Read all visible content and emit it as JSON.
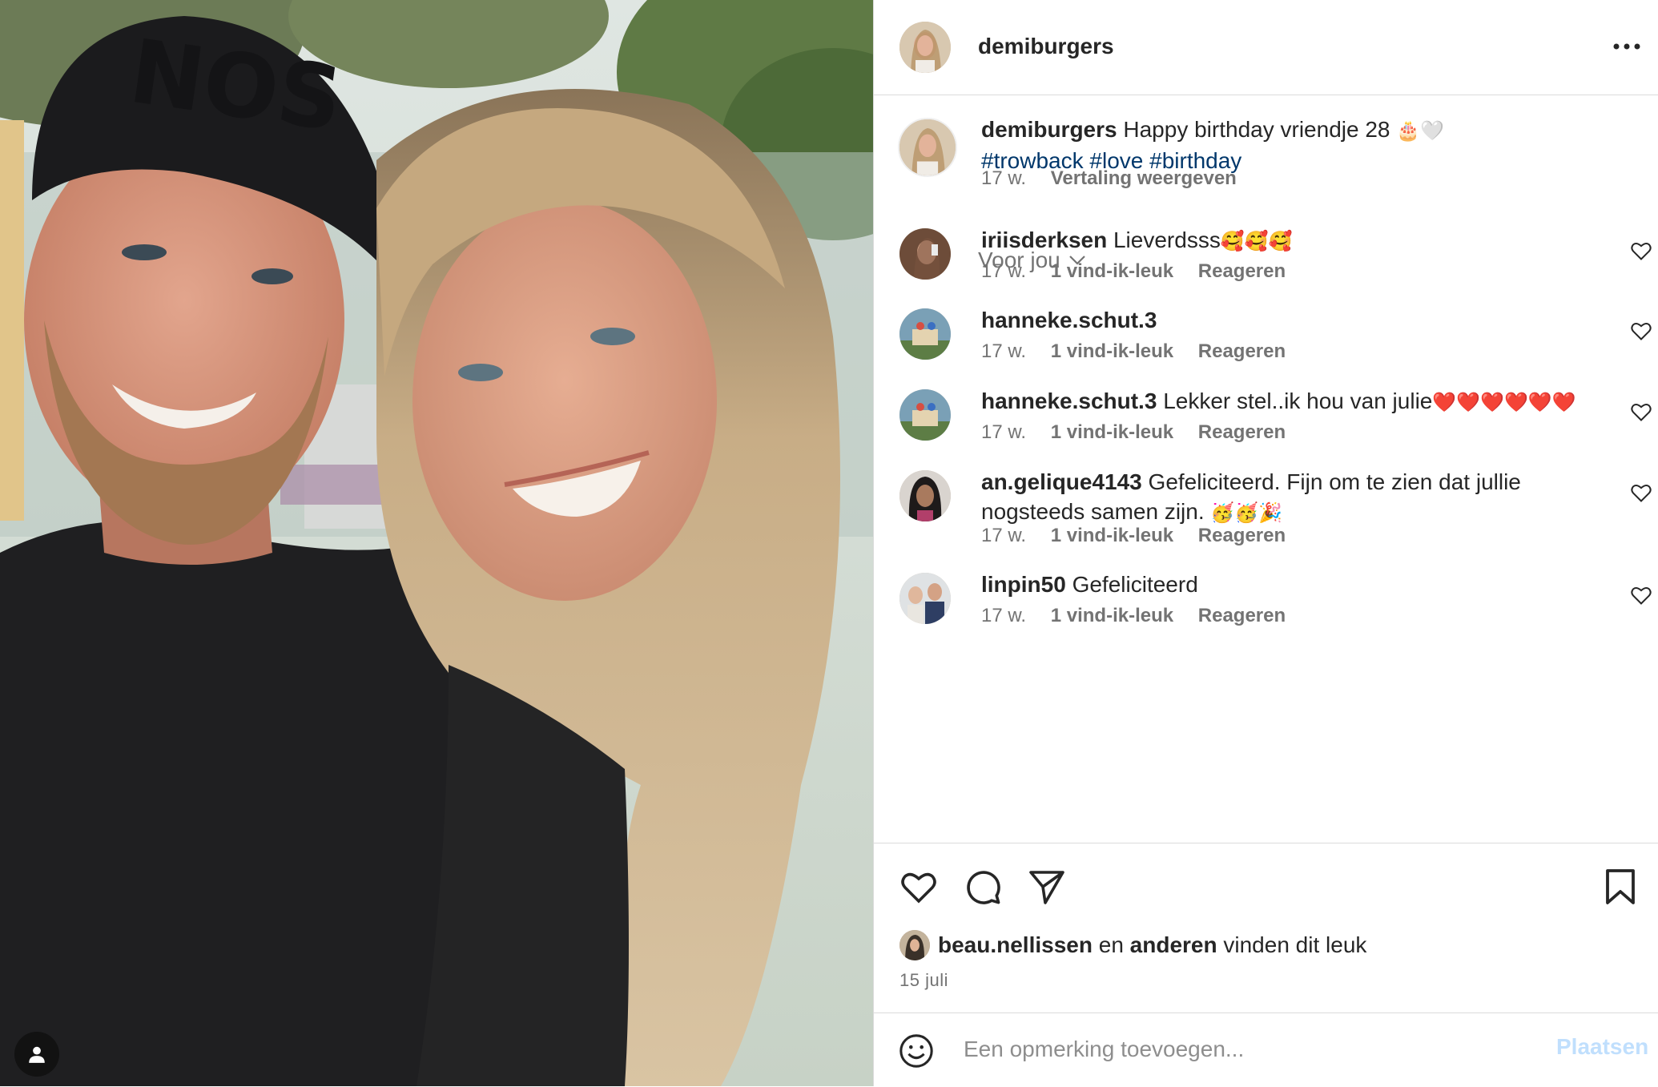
{
  "post": {
    "author": "demiburgers",
    "more_icon": "more-horizontal-icon"
  },
  "caption": {
    "user": "demiburgers",
    "text": "Happy birthday vriendje 28 ",
    "emoji": "🎂🤍",
    "hashtags": [
      "#trowback",
      "#love",
      "#birthday"
    ],
    "time": "17 w.",
    "translate": "Vertaling weergeven"
  },
  "sort": {
    "label": "Voor jou",
    "icon": "chevron-down-icon"
  },
  "comments": [
    {
      "user": "iriisderksen",
      "text": "Lieverdsss",
      "emoji": "🥰🥰🥰",
      "time": "17 w.",
      "likes": "1 vind-ik-leuk",
      "reply": "Reageren"
    },
    {
      "user": "hanneke.schut.3",
      "text": "",
      "emoji": "",
      "time": "17 w.",
      "likes": "1 vind-ik-leuk",
      "reply": "Reageren"
    },
    {
      "user": "hanneke.schut.3",
      "text": "Lekker stel..ik hou van julie",
      "emoji": "❤️❤️❤️❤️❤️❤️",
      "time": "17 w.",
      "likes": "1 vind-ik-leuk",
      "reply": "Reageren"
    },
    {
      "user": "an.gelique4143",
      "text": "Gefeliciteerd. Fijn om te zien dat jullie nogsteeds samen zijn. ",
      "emoji": "🥳🥳🎉",
      "time": "17 w.",
      "likes": "1 vind-ik-leuk",
      "reply": "Reageren"
    },
    {
      "user": "linpin50",
      "text": "Gefeliciteerd",
      "emoji": "",
      "time": "17 w.",
      "likes": "1 vind-ik-leuk",
      "reply": "Reageren"
    }
  ],
  "actions": {
    "like_icon": "heart-icon",
    "comment_icon": "comment-icon",
    "share_icon": "send-icon",
    "save_icon": "bookmark-icon"
  },
  "likes": {
    "user": "beau.nellissen",
    "connector": " en ",
    "others": "anderen",
    "suffix": " vinden dit leuk"
  },
  "date": "15 juli",
  "add_comment": {
    "placeholder": "Een opmerking toevoegen...",
    "post_label": "Plaatsen",
    "emoji_icon": "smiley-icon"
  },
  "colors": {
    "hashtag": "#00376b",
    "secondary_text": "#737373",
    "post_button_disabled": "#c0dffd",
    "divider": "#dbdbdb"
  }
}
